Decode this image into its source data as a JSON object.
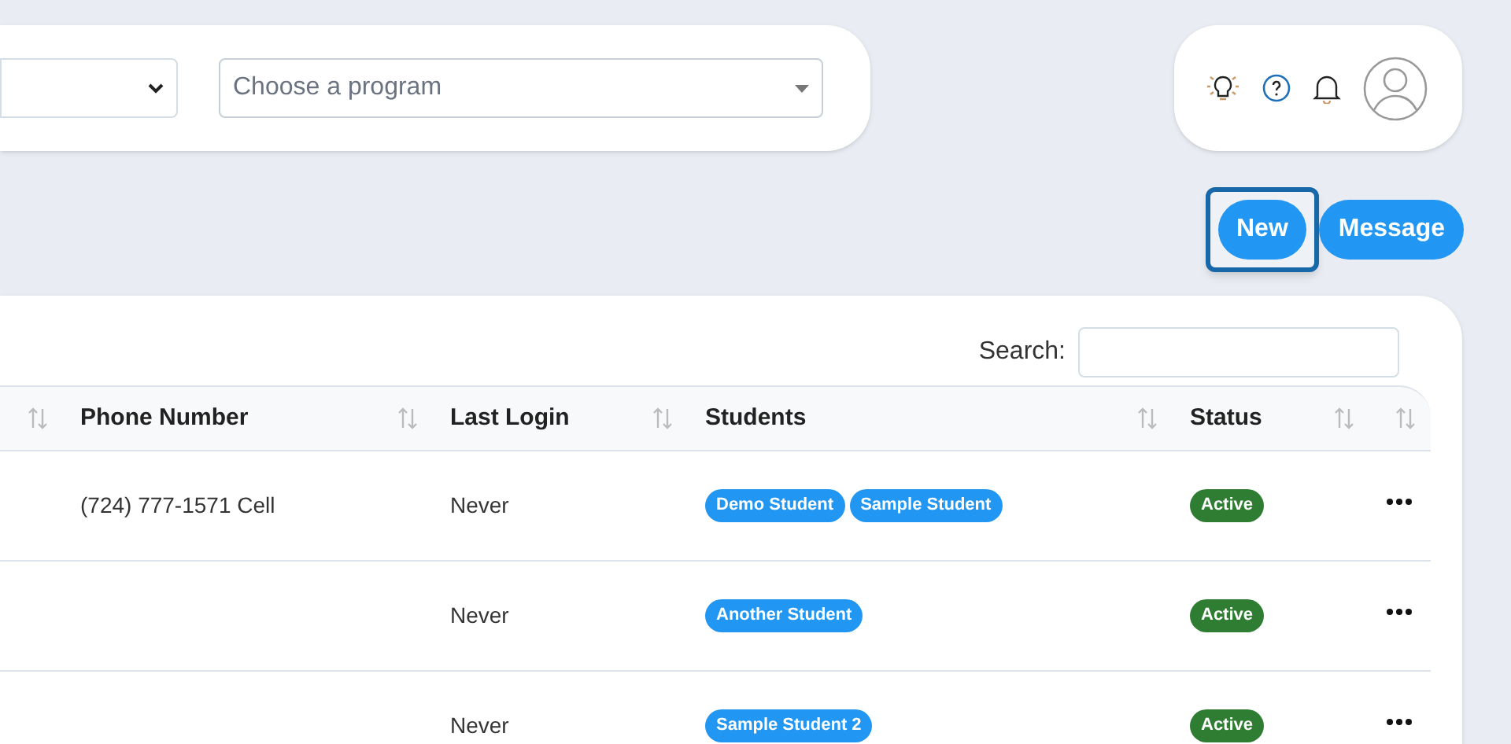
{
  "filters": {
    "program_select": {
      "placeholder": "Choose a program"
    }
  },
  "buttons": [
    {
      "label": "New",
      "focused": true
    },
    {
      "label": "Message",
      "focused": false
    }
  ],
  "table": {
    "search_label": "Search:",
    "columns": [
      {},
      {
        "label": "Phone Number"
      },
      {
        "label": "Last Login"
      },
      {
        "label": "Students"
      },
      {
        "label": "Status"
      },
      {}
    ],
    "rows": [
      {
        "phone": "(724) 777-1571 Cell",
        "last_login": "Never",
        "students": [
          "Demo Student",
          "Sample Student"
        ],
        "status": "Active"
      },
      {
        "last_login": "Never",
        "students": [
          "Another Student"
        ],
        "status": "Active"
      },
      {
        "last_login": "Never",
        "students": [
          "Sample Student 2"
        ],
        "status": "Active"
      }
    ]
  }
}
